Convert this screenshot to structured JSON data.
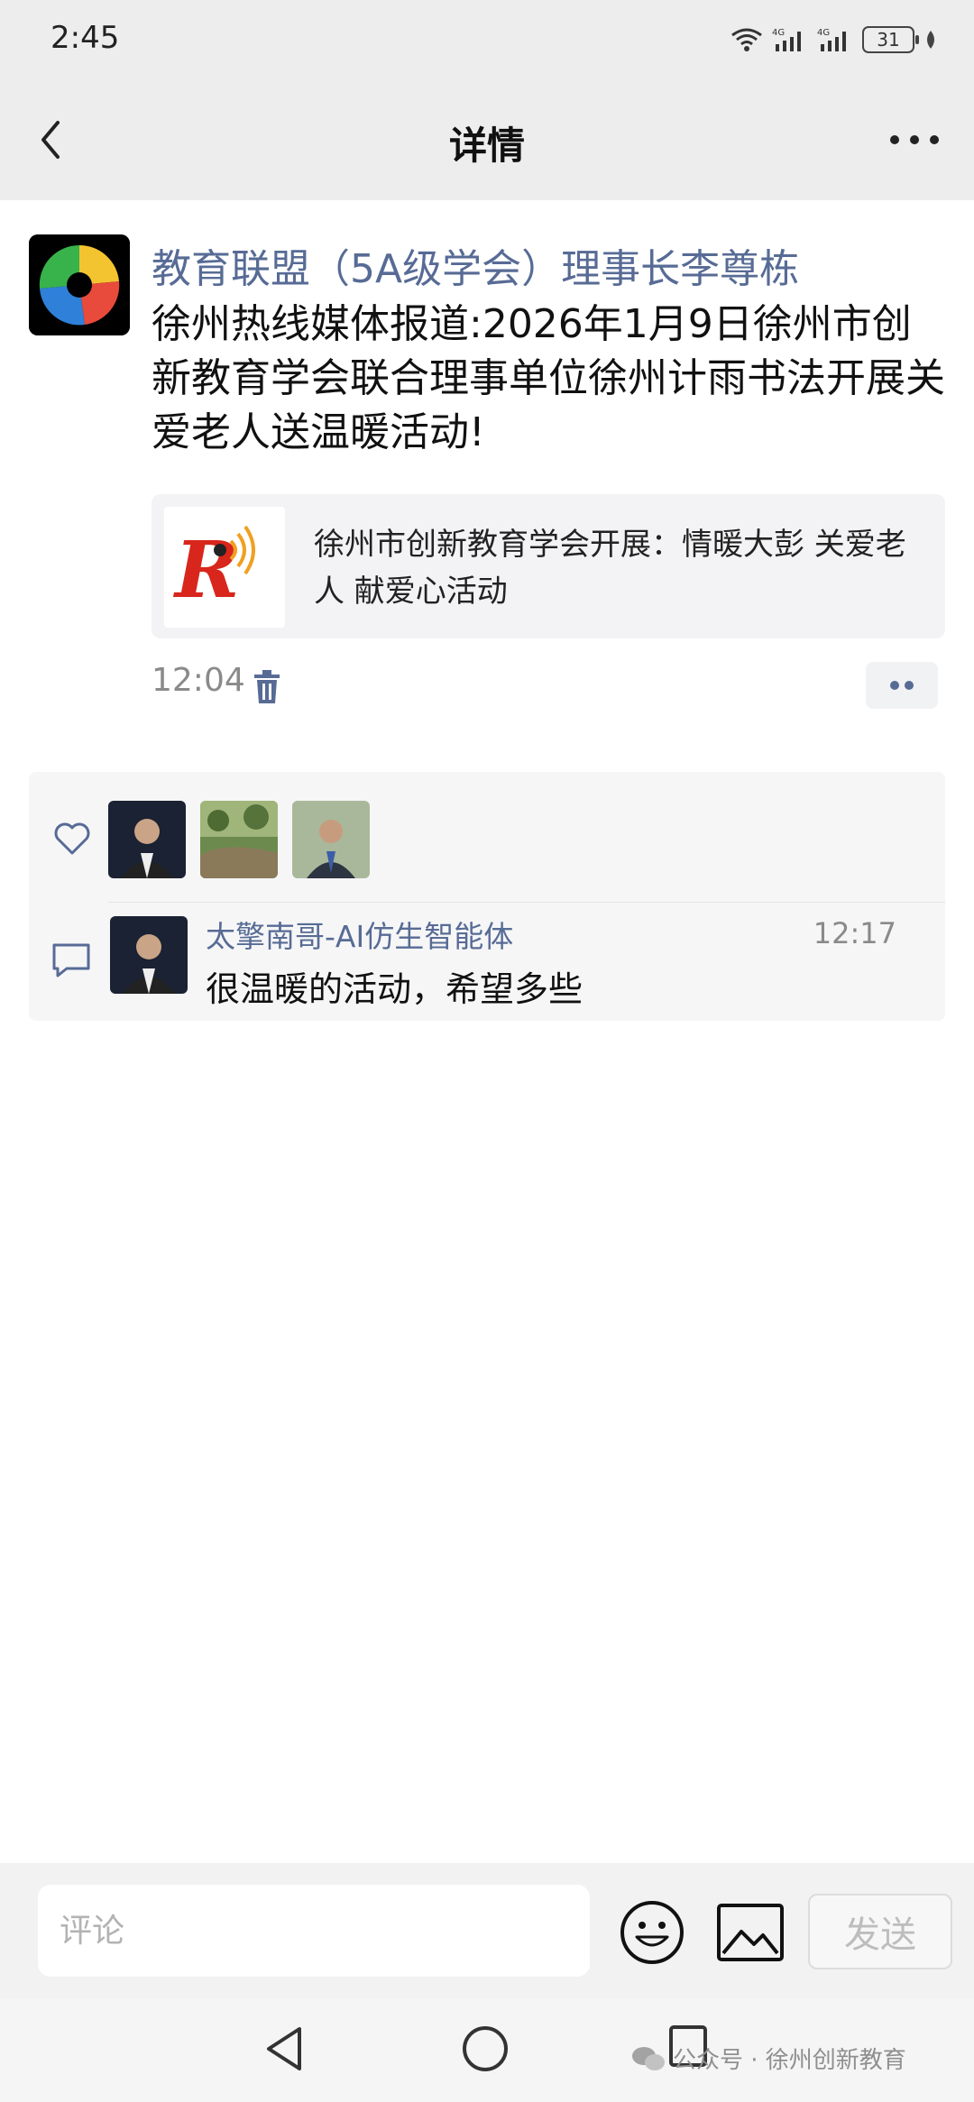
{
  "status": {
    "time": "2:45",
    "battery": "31",
    "network": "4G"
  },
  "header": {
    "title": "详情"
  },
  "post": {
    "author": "教育联盟（5A级学会）理事长李尊栋",
    "text": "徐州热线媒体报道:2026年1月9日徐州市创新教育学会联合理事单位徐州计雨书法开展关爱老人送温暖活动!",
    "link_title": "徐州市创新教育学会开展：情暖大彭 关爱老人 献爱心活动",
    "time": "12:04"
  },
  "comment": {
    "author": "太擎南哥-AI仿生智能体",
    "time": "12:17",
    "text": "很温暖的活动，希望多些"
  },
  "input": {
    "placeholder": "评论",
    "send_label": "发送"
  },
  "watermark": "公众号 · 徐州创新教育",
  "colors": {
    "link_blue": "#576b95",
    "header_bg": "#ededed",
    "panel_bg": "#f6f6f7"
  }
}
